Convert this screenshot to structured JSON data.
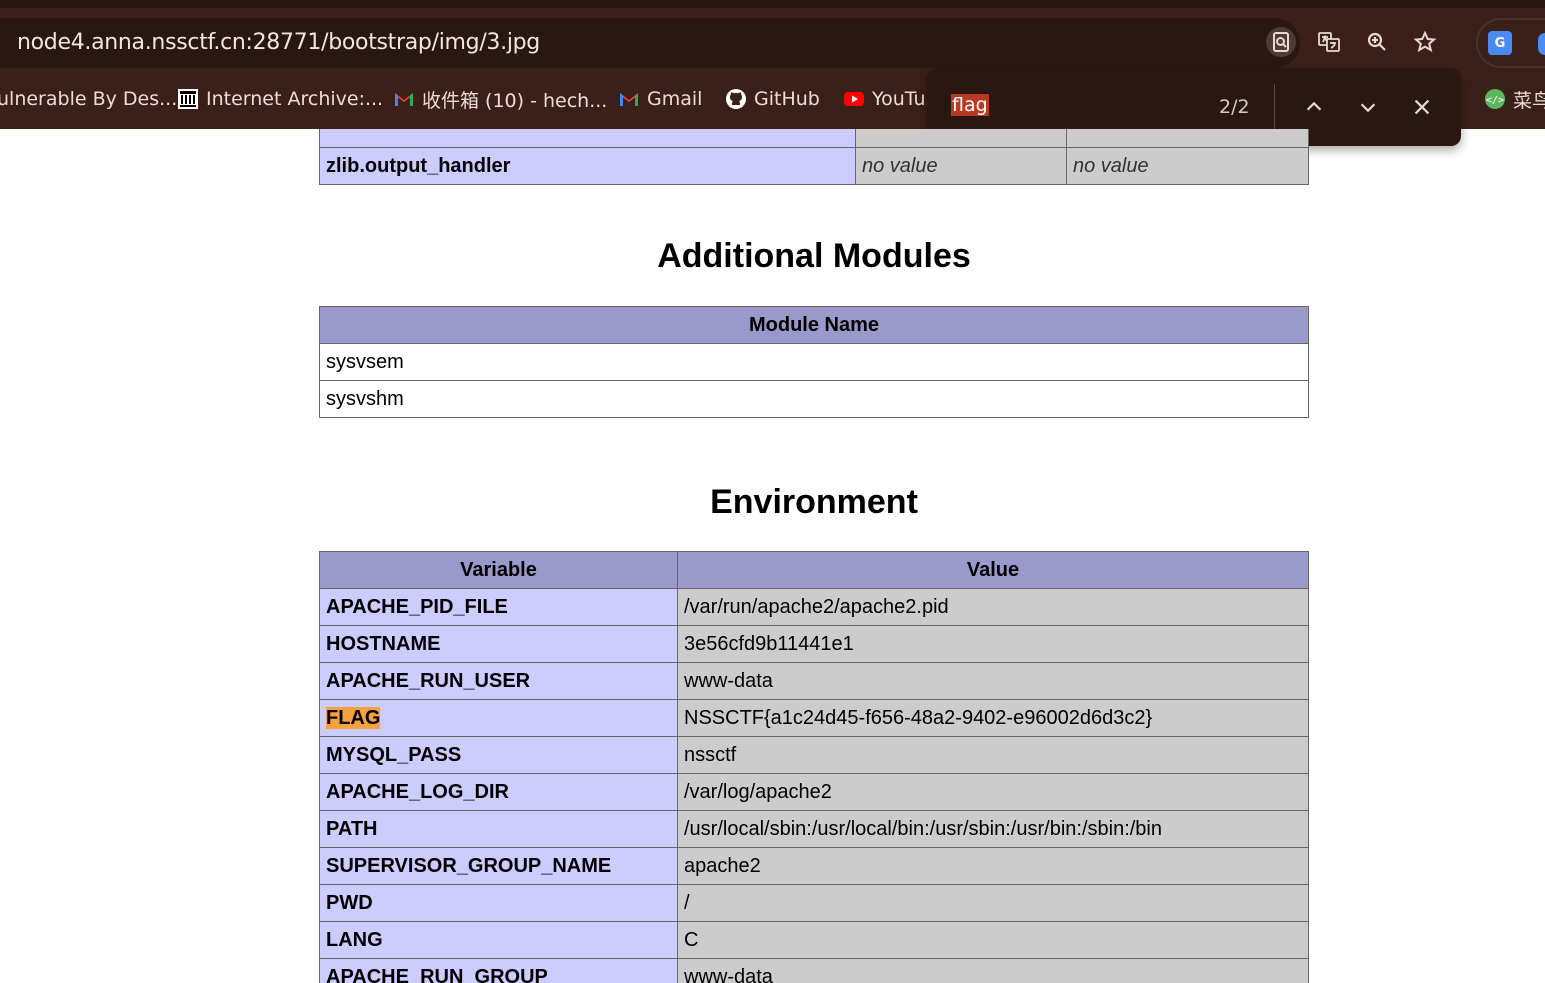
{
  "browser": {
    "url": "node4.anna.nssctf.cn:28771/bootstrap/img/3.jpg",
    "bookmarks": [
      {
        "label": "ulnerable By Des...",
        "icon": "none"
      },
      {
        "label": "Internet Archive:...",
        "icon": "archive-icon"
      },
      {
        "label": "收件箱 (10) - hech...",
        "icon": "gmail-icon"
      },
      {
        "label": "Gmail",
        "icon": "gmail-icon"
      },
      {
        "label": "GitHub",
        "icon": "github-icon"
      },
      {
        "label": "YouTu",
        "icon": "youtube-icon"
      },
      {
        "label": "菜鸟",
        "icon": "runoob-icon"
      }
    ],
    "find": {
      "query": "flag",
      "count": "2/2"
    }
  },
  "page": {
    "top_table": {
      "directive": "zlib.output_handler",
      "local": "no value",
      "master": "no value"
    },
    "modules": {
      "heading": "Additional Modules",
      "column": "Module Name",
      "rows": [
        "sysvsem",
        "sysvshm"
      ]
    },
    "environment": {
      "heading": "Environment",
      "col_variable": "Variable",
      "col_value": "Value",
      "rows": [
        {
          "name": "APACHE_PID_FILE",
          "value": "/var/run/apache2/apache2.pid"
        },
        {
          "name": "HOSTNAME",
          "value": "3e56cfd9b11441e1"
        },
        {
          "name": "APACHE_RUN_USER",
          "value": "www-data"
        },
        {
          "name": "FLAG",
          "value": "NSSCTF{a1c24d45-f656-48a2-9402-e96002d6d3c2}"
        },
        {
          "name": "MYSQL_PASS",
          "value": "nssctf"
        },
        {
          "name": "APACHE_LOG_DIR",
          "value": "/var/log/apache2"
        },
        {
          "name": "PATH",
          "value": "/usr/local/sbin:/usr/local/bin:/usr/sbin:/usr/bin:/sbin:/bin"
        },
        {
          "name": "SUPERVISOR_GROUP_NAME",
          "value": "apache2"
        },
        {
          "name": "PWD",
          "value": "/"
        },
        {
          "name": "LANG",
          "value": "C"
        },
        {
          "name": "APACHE_RUN_GROUP",
          "value": "www-data"
        }
      ]
    }
  },
  "colors": {
    "chrome": "#3b2019",
    "header_cell": "#9999cc",
    "name_cell": "#ccccff",
    "value_cell": "#cccccc",
    "find_highlight": "#f5a13d",
    "find_active": "#b83a22"
  }
}
